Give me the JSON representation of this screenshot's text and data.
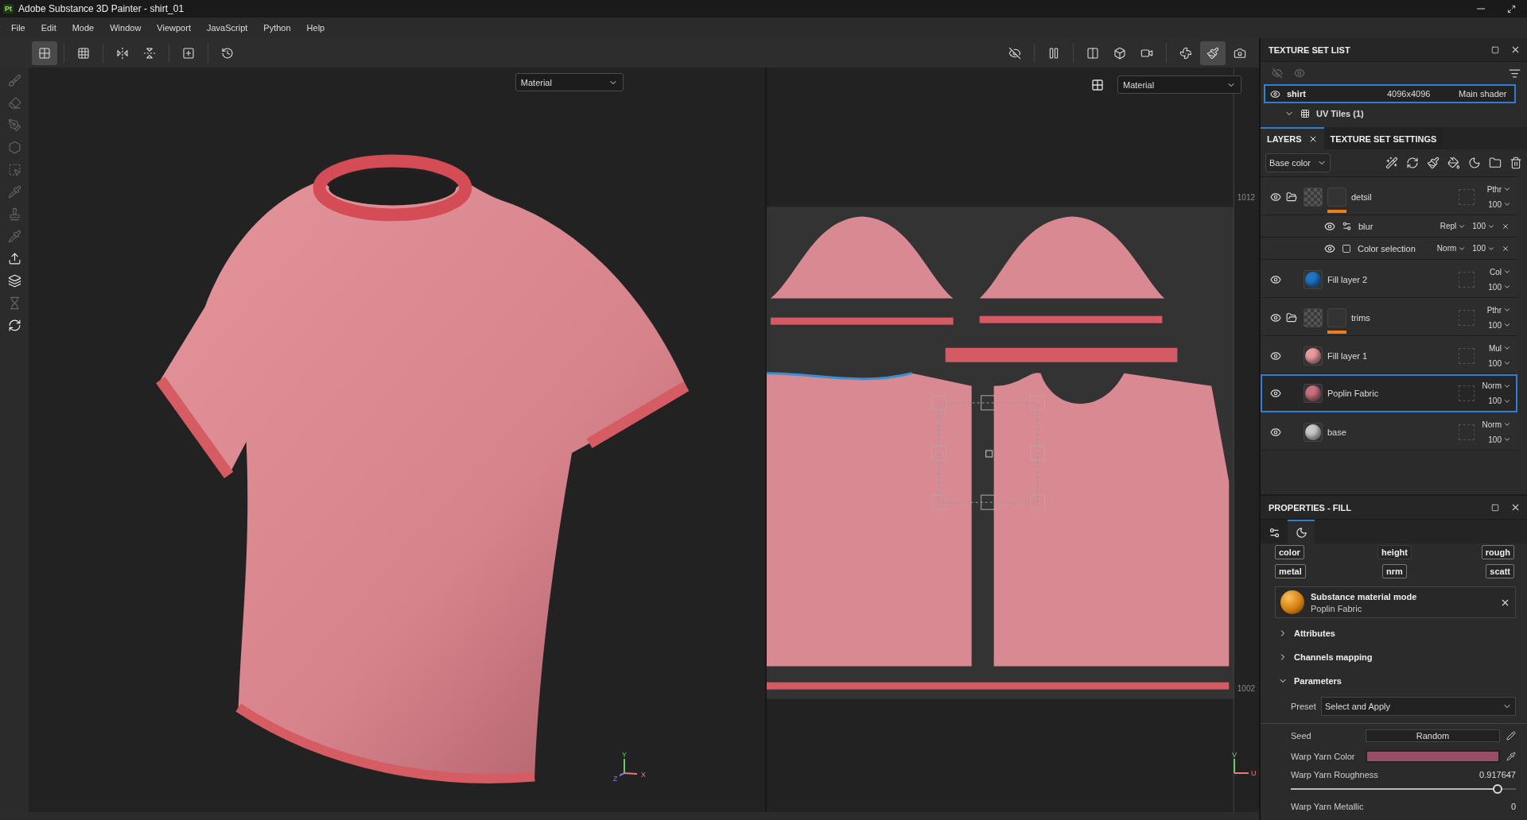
{
  "window": {
    "badge": "Pt",
    "title": "Adobe Substance 3D Painter - shirt_01"
  },
  "menu": [
    "File",
    "Edit",
    "Mode",
    "Window",
    "Viewport",
    "JavaScript",
    "Python",
    "Help"
  ],
  "toolbar": {
    "left_tools": [
      {
        "selected": true
      },
      {
        "selected": false
      },
      {
        "selected": false
      },
      {
        "selected": false
      },
      {
        "selected": false
      },
      {
        "selected": false
      }
    ],
    "right_tools": [
      {
        "selected": false
      },
      {
        "selected": false
      },
      {
        "selected": false
      },
      {
        "selected": false
      },
      {
        "selected": false
      },
      {
        "selected": false
      },
      {
        "selected": true
      },
      {
        "selected": false
      }
    ]
  },
  "tool_strip": [
    {
      "enabled": false
    },
    {
      "enabled": false
    },
    {
      "enabled": false
    },
    {
      "enabled": false
    },
    {
      "enabled": false
    },
    {
      "enabled": false
    },
    {
      "enabled": false
    },
    {
      "enabled": false
    },
    {
      "enabled": true
    },
    {
      "enabled": true
    },
    {
      "enabled": false
    },
    {
      "enabled": true
    }
  ],
  "viewport_3d": {
    "channel_select": "Material",
    "axes": [
      "Y",
      "Z",
      "X"
    ]
  },
  "viewport_2d": {
    "channel_select": "Material",
    "tile_labels": [
      "1012",
      "1002"
    ],
    "axes": [
      "V",
      "U"
    ]
  },
  "texture_set_list": {
    "title": "TEXTURE SET LIST",
    "sets": [
      {
        "name": "shirt",
        "resolution": "4096x4096",
        "shader": "Main shader",
        "selected": true
      }
    ],
    "uv_tiles": "UV Tiles (1)"
  },
  "layers_panel": {
    "tabs": [
      {
        "label": "LAYERS",
        "selected": true
      },
      {
        "label": "TEXTURE SET SETTINGS",
        "selected": false
      }
    ],
    "channel": "Base color",
    "layers": [
      {
        "kind": "folder",
        "name": "detsil",
        "blend": "Pthr",
        "opacity": "100",
        "selected": false,
        "effects": [
          {
            "kind": "filter",
            "name": "blur",
            "blend": "Repl",
            "opacity": "100"
          },
          {
            "kind": "selection",
            "name": "Color selection",
            "blend": "Norm",
            "opacity": "100"
          }
        ]
      },
      {
        "kind": "fill",
        "name": "Fill layer 2",
        "blend": "Col",
        "opacity": "100",
        "selected": false,
        "color": "#1f74c4"
      },
      {
        "kind": "folder",
        "name": "trims",
        "blend": "Pthr",
        "opacity": "100",
        "selected": false
      },
      {
        "kind": "fill",
        "name": "Fill layer 1",
        "blend": "Mul",
        "opacity": "100",
        "selected": false,
        "color": "#e89a9c"
      },
      {
        "kind": "fill",
        "name": "Poplin Fabric",
        "blend": "Norm",
        "opacity": "100",
        "selected": true,
        "color": "#c8707e"
      },
      {
        "kind": "fill",
        "name": "base",
        "blend": "Norm",
        "opacity": "100",
        "selected": false,
        "color": "#c8c8c8"
      }
    ]
  },
  "properties": {
    "title": "PROPERTIES - FILL",
    "tabs": [
      {
        "selected": false
      },
      {
        "selected": true
      }
    ],
    "channels": [
      {
        "label": "color",
        "on": true
      },
      {
        "label": "height",
        "on": false
      },
      {
        "label": "rough",
        "on": true
      },
      {
        "label": "metal",
        "on": true
      },
      {
        "label": "nrm",
        "on": true
      },
      {
        "label": "scatt",
        "on": true
      }
    ],
    "material": {
      "title": "Substance material mode",
      "name": "Poplin Fabric"
    },
    "sections": [
      {
        "label": "Attributes",
        "expanded": false
      },
      {
        "label": "Channels mapping",
        "expanded": false
      },
      {
        "label": "Parameters",
        "expanded": true
      }
    ],
    "params": [
      {
        "kind": "select",
        "label": "Preset",
        "value": "Select and Apply"
      },
      {
        "kind": "button",
        "label": "Seed",
        "value": "Random"
      },
      {
        "kind": "color",
        "label": "Warp Yarn Color",
        "color": "#9a4d66"
      },
      {
        "kind": "slider",
        "label": "Warp Yarn Roughness",
        "reading": "0.917647",
        "level": 0.917647
      },
      {
        "kind": "value",
        "label": "Warp Yarn Metallic",
        "reading": "0"
      }
    ]
  }
}
